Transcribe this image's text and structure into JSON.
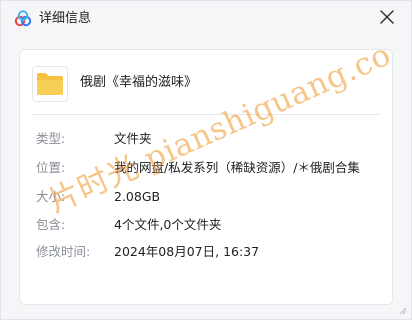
{
  "window": {
    "title": "详细信息",
    "app_logo_icon": "cloud-logo-icon",
    "close_icon": "close-icon"
  },
  "file": {
    "icon": "folder-icon",
    "name": "俄剧《幸福的滋味》"
  },
  "details": [
    {
      "label": "类型:",
      "value": "文件夹"
    },
    {
      "label": "位置:",
      "value": "我的网盘/私发系列（稀缺资源）/＊俄剧合集"
    },
    {
      "label": "大小:",
      "value": "2.08GB"
    },
    {
      "label": "包含:",
      "value": "4个文件,0个文件夹"
    },
    {
      "label": "修改时间:",
      "value": "2024年08月07日, 16:37"
    }
  ],
  "watermark": "片时光 pianshiguang.com",
  "colors": {
    "folder": "#f5c242",
    "watermark": "#ee9628",
    "label_text": "#8a8f99"
  }
}
